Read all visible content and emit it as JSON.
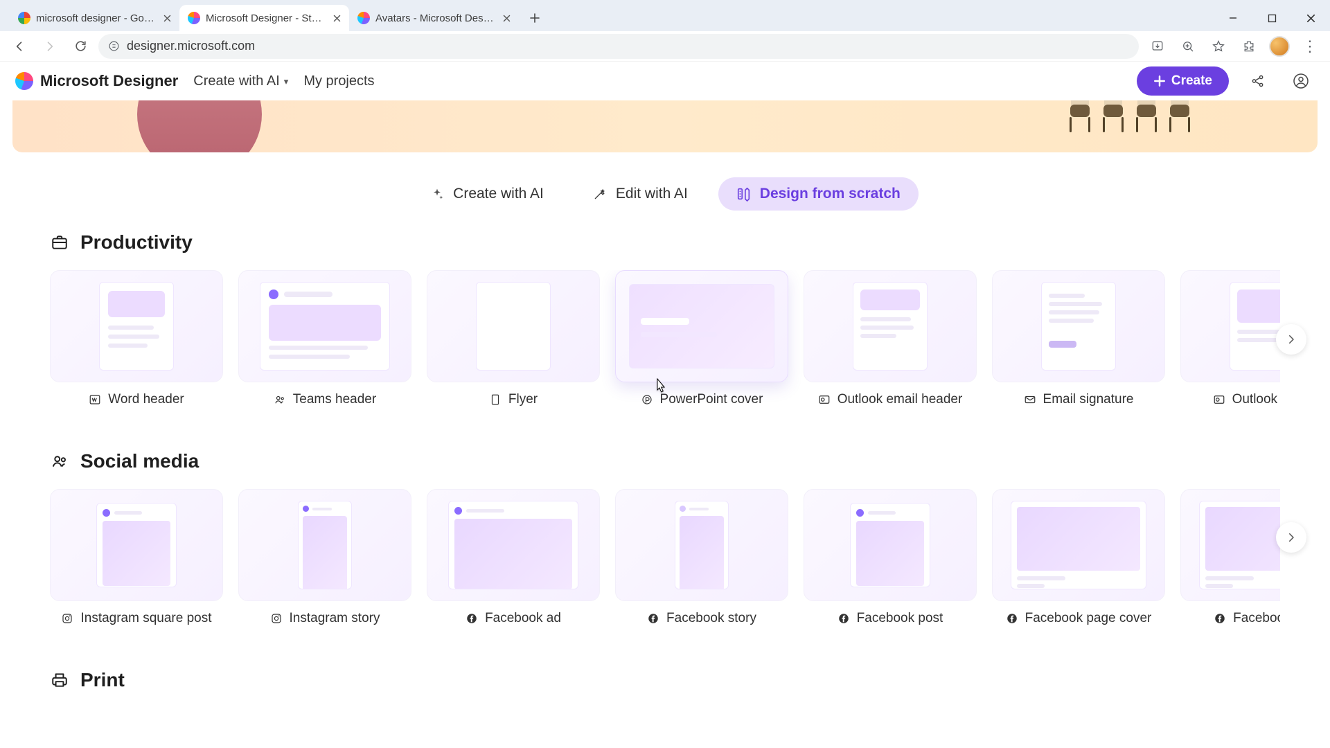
{
  "browser": {
    "tabs": [
      {
        "title": "microsoft designer - Google Se",
        "favicon": "conic-gradient(#ea4335 0 90deg,#fbbc05 90deg 180deg,#34a853 180deg 270deg,#4285f4 270deg 360deg)",
        "active": false
      },
      {
        "title": "Microsoft Designer - Stunning",
        "favicon": "conic-gradient(#ff477e 0 90deg,#7b61ff 90deg 200deg,#1cc7ff 200deg 290deg,#ff8a00 290deg 360deg)",
        "active": true
      },
      {
        "title": "Avatars - Microsoft Designer",
        "favicon": "conic-gradient(#ff477e 0 90deg,#7b61ff 90deg 200deg,#1cc7ff 200deg 290deg,#ff8a00 290deg 360deg)",
        "active": false
      }
    ],
    "url": "designer.microsoft.com"
  },
  "header": {
    "brand": "Microsoft Designer",
    "create_with_ai": "Create with AI",
    "my_projects": "My projects",
    "create_button": "Create"
  },
  "modes": {
    "create_ai": "Create with AI",
    "edit_ai": "Edit with AI",
    "scratch": "Design from scratch",
    "active": "scratch"
  },
  "sections": {
    "productivity": {
      "title": "Productivity",
      "items": [
        {
          "label": "Word header",
          "icon": "word"
        },
        {
          "label": "Teams header",
          "icon": "teams"
        },
        {
          "label": "Flyer",
          "icon": "flyer"
        },
        {
          "label": "PowerPoint cover",
          "icon": "powerpoint"
        },
        {
          "label": "Outlook email header",
          "icon": "outlook"
        },
        {
          "label": "Email signature",
          "icon": "mail"
        },
        {
          "label": "Outlook Eventif",
          "icon": "outlook"
        }
      ]
    },
    "social": {
      "title": "Social media",
      "items": [
        {
          "label": "Instagram square post",
          "icon": "instagram"
        },
        {
          "label": "Instagram story",
          "icon": "instagram"
        },
        {
          "label": "Facebook ad",
          "icon": "facebook"
        },
        {
          "label": "Facebook story",
          "icon": "facebook"
        },
        {
          "label": "Facebook post",
          "icon": "facebook"
        },
        {
          "label": "Facebook page cover",
          "icon": "facebook"
        },
        {
          "label": "Facebook ever",
          "icon": "facebook"
        }
      ]
    },
    "print": {
      "title": "Print"
    }
  }
}
